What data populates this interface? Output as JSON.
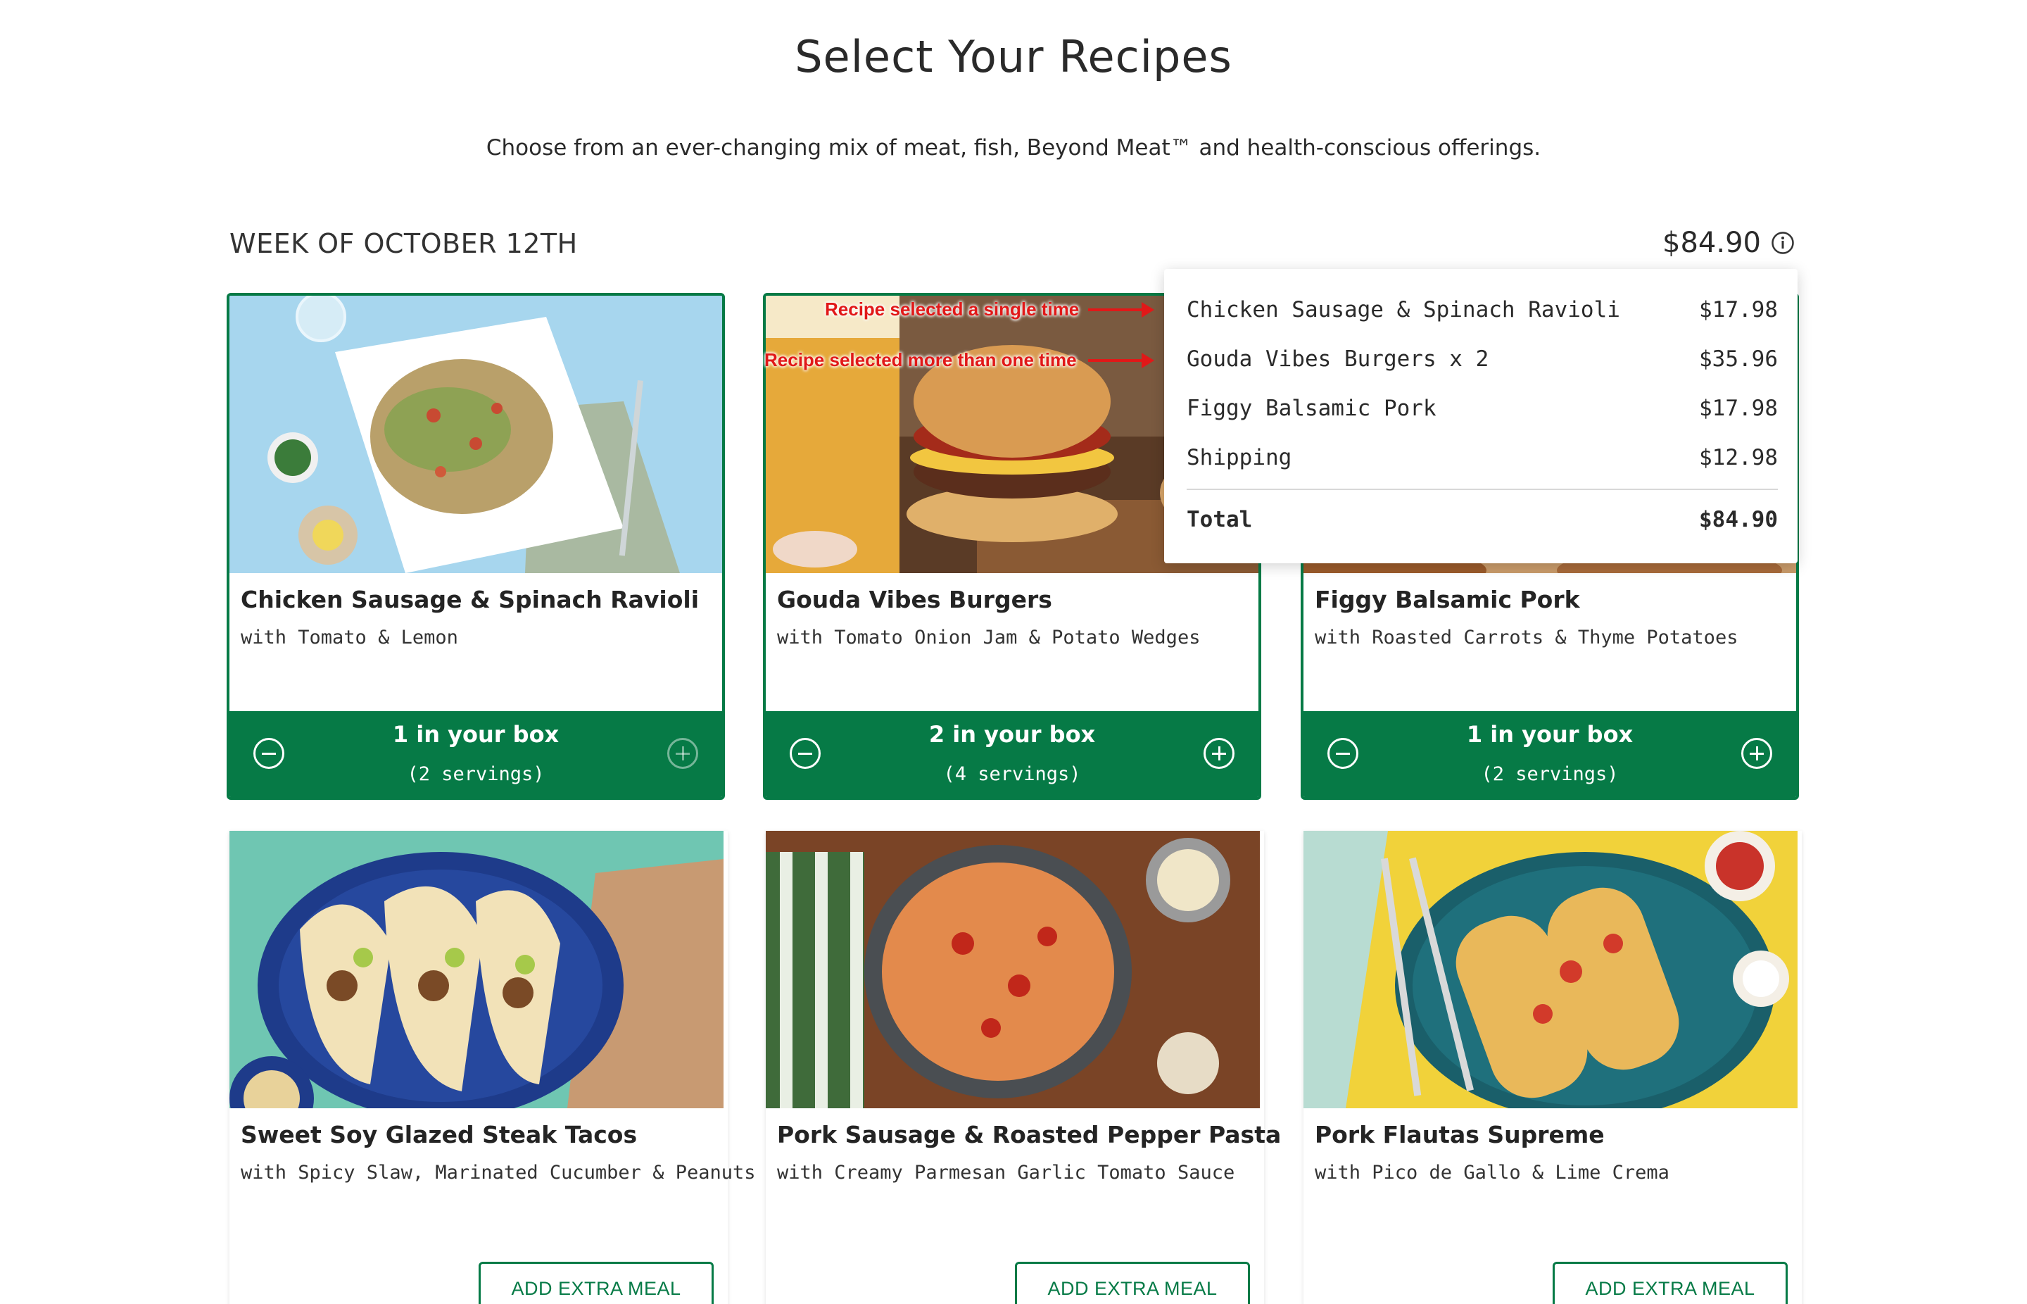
{
  "page": {
    "title": "Select Your Recipes",
    "subtitle": "Choose from an ever-changing mix of meat, fish, Beyond Meat™ and health-conscious offerings."
  },
  "week": {
    "label": "WEEK OF OCTOBER 12TH",
    "total_price": "$84.90"
  },
  "colors": {
    "brand_green": "#067a46",
    "annotation_red": "#e11818"
  },
  "annotations": {
    "single": "Recipe selected a single time",
    "multiple": "Recipe selected more than one time"
  },
  "summary": {
    "items": [
      {
        "name": "Chicken Sausage & Spinach Ravioli",
        "price": "$17.98"
      },
      {
        "name": "Gouda Vibes Burgers x 2",
        "price": "$35.96"
      },
      {
        "name": "Figgy Balsamic Pork",
        "price": "$17.98"
      },
      {
        "name": "Shipping",
        "price": "$12.98"
      }
    ],
    "total_label": "Total",
    "total_value": "$84.90"
  },
  "recipes": [
    {
      "name": "Chicken Sausage & Spinach Ravioli",
      "desc": "with Tomato & Lemon",
      "qty": "1 in your box",
      "servings": "(2 servings)"
    },
    {
      "name": "Gouda Vibes Burgers",
      "desc": "with Tomato Onion Jam & Potato Wedges",
      "qty": "2 in your box",
      "servings": "(4 servings)"
    },
    {
      "name": "Figgy Balsamic Pork",
      "desc": "with Roasted Carrots & Thyme Potatoes",
      "qty": "1 in your box",
      "servings": "(2 servings)"
    },
    {
      "name": "Sweet Soy Glazed Steak Tacos",
      "desc": "with Spicy Slaw, Marinated Cucumber & Peanuts",
      "action": "ADD EXTRA MEAL"
    },
    {
      "name": "Pork Sausage & Roasted Pepper Pasta",
      "desc": "with Creamy Parmesan Garlic Tomato Sauce",
      "action": "ADD EXTRA MEAL"
    },
    {
      "name": "Pork Flautas Supreme",
      "desc": "with Pico de Gallo & Lime Crema",
      "action": "ADD EXTRA MEAL"
    }
  ]
}
